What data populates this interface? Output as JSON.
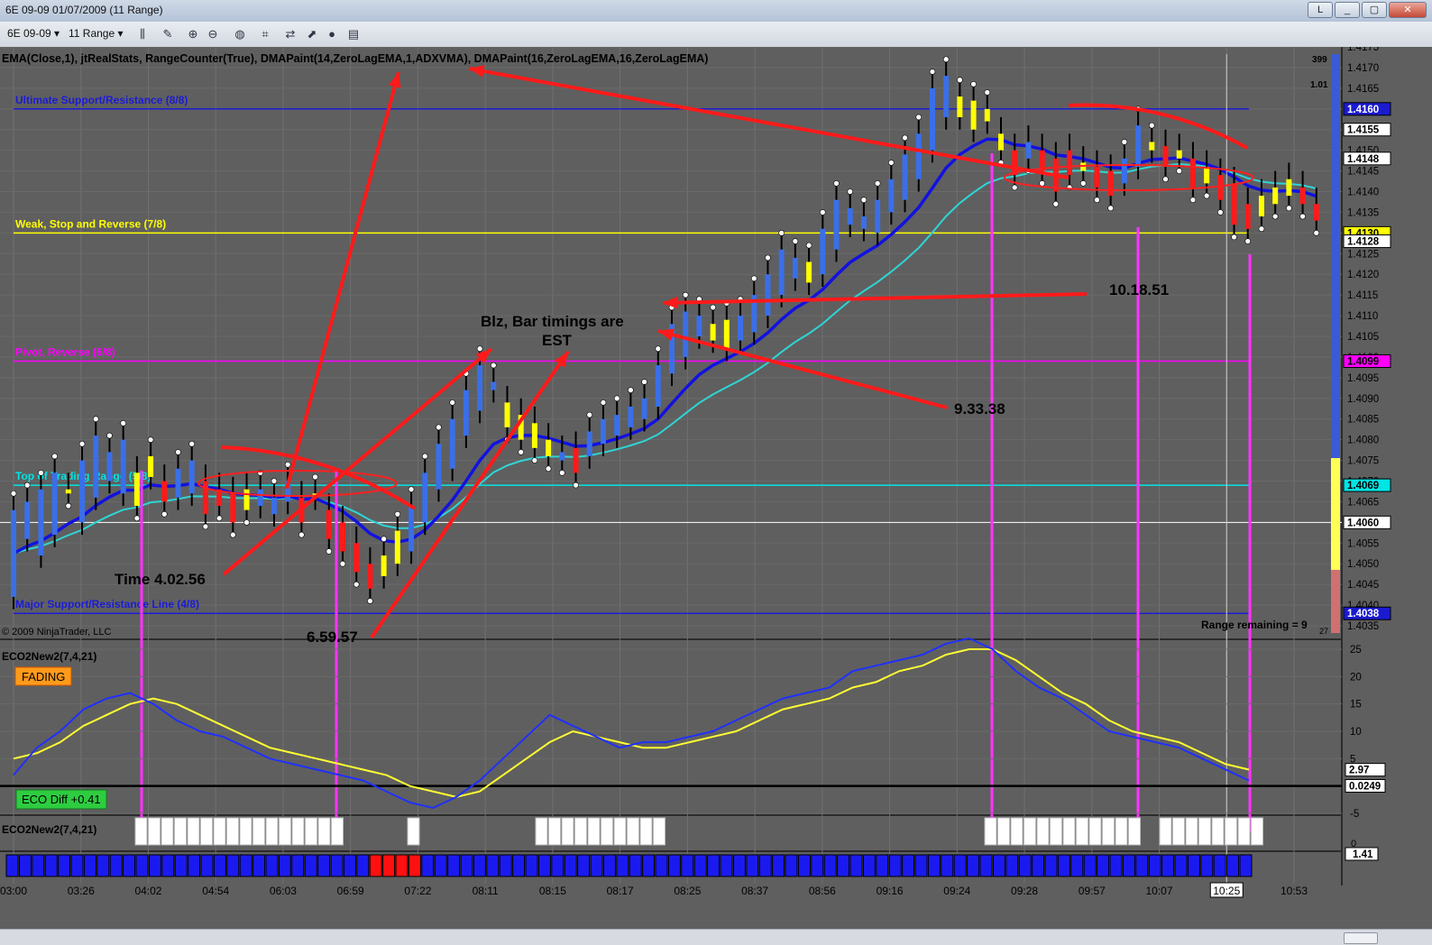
{
  "window": {
    "title": "6E 09-09  01/07/2009 (11 Range)",
    "buttons": [
      "L",
      "_",
      "▢",
      "✕"
    ]
  },
  "toolbar": {
    "instrument": "6E 09-09 ▾",
    "interval": "11 Range ▾"
  },
  "indicators_header": "EMA(Close,1),  jtRealStats,  RangeCounter(True),  DMAPaint(14,ZeroLagEMA,1,ADXVMA),  DMAPaint(16,ZeroLagEMA,16,ZeroLagEMA)",
  "copyright": "© 2009 NinjaTrader, LLC",
  "range_remaining": "Range remaining = 9",
  "corner_small": [
    "399",
    "1.01",
    "27"
  ],
  "panel2": {
    "title": "ECO2New2(7,4,21)",
    "badge": "FADING",
    "diff": "ECO Diff +0.41"
  },
  "panel3": {
    "title": "ECO2New2(7,4,21)"
  },
  "annotations": {
    "note1": "Blz, Bar timings are",
    "note2": "EST",
    "t1": "Time 4.02.56",
    "t2": "6.59.57",
    "t3": "9.33.38",
    "t4": "10.18.51"
  },
  "chart_data": {
    "type": "bar",
    "title": "6E 09-09 01/07/2009 (11 Range)",
    "x_labels": [
      "03:00",
      "03:26",
      "04:02",
      "04:54",
      "06:03",
      "06:59",
      "07:22",
      "08:11",
      "08:15",
      "08:17",
      "08:25",
      "08:37",
      "08:56",
      "09:16",
      "09:24",
      "09:28",
      "09:57",
      "10:07",
      "10:25",
      "10:53"
    ],
    "highlighted_x": "10:25",
    "price_axis": {
      "ylim": [
        1.4035,
        1.4175
      ],
      "ticks": [
        "1.4175",
        "1.4170",
        "1.4165",
        "1.4160",
        "1.4155",
        "1.4150",
        "1.4145",
        "1.4140",
        "1.4135",
        "1.4130",
        "1.4125",
        "1.4120",
        "1.4115",
        "1.4110",
        "1.4105",
        "1.4100",
        "1.4095",
        "1.4090",
        "1.4085",
        "1.4080",
        "1.4075",
        "1.4070",
        "1.4065",
        "1.4060",
        "1.4055",
        "1.4050",
        "1.4045",
        "1.4040",
        "1.4035"
      ],
      "flags": [
        {
          "label": "1.4160",
          "value": 1.416,
          "color": "#1a1ad0"
        },
        {
          "label": "1.4155",
          "value": 1.4155,
          "color": "#ffffff"
        },
        {
          "label": "1.4148",
          "value": 1.4148,
          "color": "#ffffff"
        },
        {
          "label": "1.4130",
          "value": 1.413,
          "color": "#ffff00"
        },
        {
          "label": "1.4128",
          "value": 1.4128,
          "color": "#ffffff"
        },
        {
          "label": "1.4099",
          "value": 1.4099,
          "color": "#ff00ff"
        },
        {
          "label": "1.4069",
          "value": 1.4069,
          "color": "#00e5e5"
        },
        {
          "label": "1.4060",
          "value": 1.406,
          "color": "#ffffff"
        },
        {
          "label": "1.4038",
          "value": 1.4038,
          "color": "#1a1ad0"
        }
      ]
    },
    "levels": [
      {
        "name": "Ultimate Support/Resistance (8/8)",
        "value": 1.416,
        "color": "#1c1cd6"
      },
      {
        "name": "Weak, Stop and Reverse (7/8)",
        "value": 1.413,
        "color": "#ffff00"
      },
      {
        "name": "Pivot, Reverse (6/8)",
        "value": 1.4099,
        "color": "#ff00ff"
      },
      {
        "name": "Top of Trading Range (5/8)",
        "value": 1.4069,
        "color": "#00e5e5"
      },
      {
        "name": "Major Support/Resistance Line (4/8)",
        "value": 1.4038,
        "color": "#1c1cd6"
      }
    ],
    "last_price": 1.406,
    "bars": [
      {
        "o": 1.4042,
        "c": 1.4063,
        "col": "blue"
      },
      {
        "o": 1.4056,
        "c": 1.4065,
        "col": "blue"
      },
      {
        "o": 1.4052,
        "c": 1.4068,
        "col": "blue"
      },
      {
        "o": 1.4057,
        "c": 1.4072,
        "col": "blue"
      },
      {
        "o": 1.4068,
        "c": 1.4067,
        "col": "yellow"
      },
      {
        "o": 1.406,
        "c": 1.4075,
        "col": "blue"
      },
      {
        "o": 1.4066,
        "c": 1.4081,
        "col": "blue"
      },
      {
        "o": 1.407,
        "c": 1.4077,
        "col": "blue"
      },
      {
        "o": 1.4067,
        "c": 1.408,
        "col": "blue"
      },
      {
        "o": 1.4072,
        "c": 1.4064,
        "col": "yellow"
      },
      {
        "o": 1.4071,
        "c": 1.4076,
        "col": "yellow"
      },
      {
        "o": 1.407,
        "c": 1.4065,
        "col": "red"
      },
      {
        "o": 1.4066,
        "c": 1.4073,
        "col": "blue"
      },
      {
        "o": 1.4067,
        "c": 1.4075,
        "col": "blue"
      },
      {
        "o": 1.407,
        "c": 1.4062,
        "col": "red"
      },
      {
        "o": 1.4068,
        "c": 1.4064,
        "col": "red"
      },
      {
        "o": 1.4067,
        "c": 1.406,
        "col": "red"
      },
      {
        "o": 1.4068,
        "c": 1.4063,
        "col": "yellow"
      },
      {
        "o": 1.4064,
        "c": 1.4068,
        "col": "blue"
      },
      {
        "o": 1.4062,
        "c": 1.4066,
        "col": "blue"
      },
      {
        "o": 1.4065,
        "c": 1.407,
        "col": "blue"
      },
      {
        "o": 1.4066,
        "c": 1.406,
        "col": "red"
      },
      {
        "o": 1.4066,
        "c": 1.4067,
        "col": "yellow"
      },
      {
        "o": 1.4063,
        "c": 1.4056,
        "col": "red"
      },
      {
        "o": 1.406,
        "c": 1.4053,
        "col": "red"
      },
      {
        "o": 1.4055,
        "c": 1.4048,
        "col": "red"
      },
      {
        "o": 1.405,
        "c": 1.4044,
        "col": "red"
      },
      {
        "o": 1.4047,
        "c": 1.4052,
        "col": "yellow"
      },
      {
        "o": 1.405,
        "c": 1.4058,
        "col": "yellow"
      },
      {
        "o": 1.4053,
        "c": 1.4064,
        "col": "blue"
      },
      {
        "o": 1.406,
        "c": 1.4072,
        "col": "blue"
      },
      {
        "o": 1.4068,
        "c": 1.4079,
        "col": "blue"
      },
      {
        "o": 1.4073,
        "c": 1.4085,
        "col": "blue"
      },
      {
        "o": 1.4081,
        "c": 1.4092,
        "col": "blue"
      },
      {
        "o": 1.4087,
        "c": 1.4098,
        "col": "blue"
      },
      {
        "o": 1.4092,
        "c": 1.4094,
        "col": "blue"
      },
      {
        "o": 1.4089,
        "c": 1.4083,
        "col": "yellow"
      },
      {
        "o": 1.4086,
        "c": 1.408,
        "col": "yellow"
      },
      {
        "o": 1.4084,
        "c": 1.4078,
        "col": "yellow"
      },
      {
        "o": 1.408,
        "c": 1.4076,
        "col": "yellow"
      },
      {
        "o": 1.4077,
        "c": 1.4075,
        "col": "blue"
      },
      {
        "o": 1.4078,
        "c": 1.4072,
        "col": "red"
      },
      {
        "o": 1.4076,
        "c": 1.4082,
        "col": "blue"
      },
      {
        "o": 1.4079,
        "c": 1.4085,
        "col": "blue"
      },
      {
        "o": 1.4081,
        "c": 1.4086,
        "col": "blue"
      },
      {
        "o": 1.4083,
        "c": 1.4088,
        "col": "blue"
      },
      {
        "o": 1.4085,
        "c": 1.409,
        "col": "blue"
      },
      {
        "o": 1.4088,
        "c": 1.4098,
        "col": "blue"
      },
      {
        "o": 1.4096,
        "c": 1.4108,
        "col": "blue"
      },
      {
        "o": 1.41,
        "c": 1.4111,
        "col": "blue"
      },
      {
        "o": 1.4105,
        "c": 1.411,
        "col": "blue"
      },
      {
        "o": 1.4104,
        "c": 1.4108,
        "col": "yellow"
      },
      {
        "o": 1.4102,
        "c": 1.4109,
        "col": "yellow"
      },
      {
        "o": 1.4104,
        "c": 1.411,
        "col": "blue"
      },
      {
        "o": 1.4106,
        "c": 1.4115,
        "col": "blue"
      },
      {
        "o": 1.411,
        "c": 1.412,
        "col": "blue"
      },
      {
        "o": 1.4115,
        "c": 1.4126,
        "col": "blue"
      },
      {
        "o": 1.4119,
        "c": 1.4124,
        "col": "blue"
      },
      {
        "o": 1.4118,
        "c": 1.4123,
        "col": "yellow"
      },
      {
        "o": 1.412,
        "c": 1.4131,
        "col": "blue"
      },
      {
        "o": 1.4126,
        "c": 1.4138,
        "col": "blue"
      },
      {
        "o": 1.4132,
        "c": 1.4136,
        "col": "blue"
      },
      {
        "o": 1.4131,
        "c": 1.4134,
        "col": "blue"
      },
      {
        "o": 1.413,
        "c": 1.4138,
        "col": "blue"
      },
      {
        "o": 1.4135,
        "c": 1.4143,
        "col": "blue"
      },
      {
        "o": 1.4138,
        "c": 1.4149,
        "col": "blue"
      },
      {
        "o": 1.4143,
        "c": 1.4154,
        "col": "blue"
      },
      {
        "o": 1.415,
        "c": 1.4165,
        "col": "blue"
      },
      {
        "o": 1.4158,
        "c": 1.4168,
        "col": "blue"
      },
      {
        "o": 1.4158,
        "c": 1.4163,
        "col": "yellow"
      },
      {
        "o": 1.4155,
        "c": 1.4162,
        "col": "yellow"
      },
      {
        "o": 1.4157,
        "c": 1.416,
        "col": "yellow"
      },
      {
        "o": 1.4154,
        "c": 1.415,
        "col": "yellow"
      },
      {
        "o": 1.415,
        "c": 1.4144,
        "col": "red"
      },
      {
        "o": 1.4152,
        "c": 1.4148,
        "col": "blue"
      },
      {
        "o": 1.415,
        "c": 1.4145,
        "col": "red"
      },
      {
        "o": 1.4148,
        "c": 1.414,
        "col": "red"
      },
      {
        "o": 1.415,
        "c": 1.4144,
        "col": "red"
      },
      {
        "o": 1.4147,
        "c": 1.4145,
        "col": "yellow"
      },
      {
        "o": 1.4146,
        "c": 1.4141,
        "col": "red"
      },
      {
        "o": 1.4145,
        "c": 1.4139,
        "col": "red"
      },
      {
        "o": 1.4142,
        "c": 1.4148,
        "col": "blue"
      },
      {
        "o": 1.4146,
        "c": 1.4156,
        "col": "blue"
      },
      {
        "o": 1.415,
        "c": 1.4152,
        "col": "yellow"
      },
      {
        "o": 1.4151,
        "c": 1.4146,
        "col": "red"
      },
      {
        "o": 1.415,
        "c": 1.4148,
        "col": "yellow"
      },
      {
        "o": 1.4148,
        "c": 1.4141,
        "col": "red"
      },
      {
        "o": 1.4146,
        "c": 1.4142,
        "col": "yellow"
      },
      {
        "o": 1.4144,
        "c": 1.4138,
        "col": "red"
      },
      {
        "o": 1.4142,
        "c": 1.4132,
        "col": "red"
      },
      {
        "o": 1.4137,
        "c": 1.4131,
        "col": "red"
      },
      {
        "o": 1.4139,
        "c": 1.4134,
        "col": "yellow"
      },
      {
        "o": 1.4141,
        "c": 1.4137,
        "col": "yellow"
      },
      {
        "o": 1.4143,
        "c": 1.4139,
        "col": "yellow"
      },
      {
        "o": 1.4141,
        "c": 1.4137,
        "col": "red"
      },
      {
        "o": 1.4137,
        "c": 1.4133,
        "col": "red"
      }
    ],
    "oscillator": {
      "ylim": [
        -5,
        25
      ],
      "ticks": [
        "25",
        "20",
        "15",
        "10",
        "5",
        "0",
        "-5"
      ],
      "flags": [
        {
          "label": "2.97",
          "value": 2.97
        },
        {
          "label": "0.0249",
          "value": 0.0249
        }
      ],
      "fast": [
        2,
        7,
        10,
        14,
        16,
        17,
        15,
        12,
        10,
        9,
        7,
        5,
        4,
        3,
        2,
        1,
        -1,
        -3,
        -4,
        -2,
        1,
        5,
        9,
        13,
        11,
        9,
        7,
        8,
        8,
        9,
        10,
        12,
        14,
        16,
        17,
        18,
        21,
        22,
        23,
        24,
        26,
        27,
        25,
        21,
        18,
        16,
        13,
        10,
        9,
        8,
        7,
        5,
        3,
        1
      ],
      "slow": [
        5,
        6,
        8,
        11,
        13,
        15,
        16,
        15,
        13,
        11,
        9,
        7,
        6,
        5,
        4,
        3,
        2,
        0,
        -1,
        -2,
        -1,
        2,
        5,
        8,
        10,
        9,
        8,
        7,
        7,
        8,
        9,
        10,
        12,
        14,
        15,
        16,
        18,
        19,
        21,
        22,
        24,
        25,
        25,
        23,
        20,
        17,
        15,
        12,
        10,
        9,
        8,
        6,
        4,
        3
      ]
    },
    "bottom_strip": {
      "last": "1.41"
    }
  }
}
